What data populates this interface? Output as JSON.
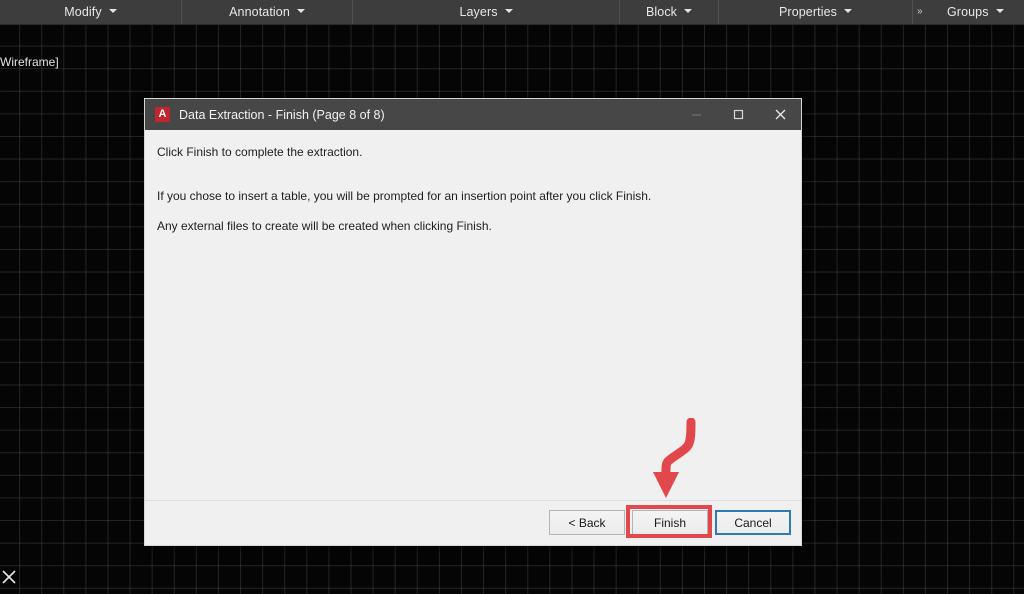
{
  "ribbon": {
    "panels": [
      {
        "label": "Modify",
        "icon": "chevron-down-icon",
        "name": "ribbon-panel-modify"
      },
      {
        "label": "Annotation",
        "icon": "chevron-down-icon",
        "name": "ribbon-panel-annotation"
      },
      {
        "label": "Layers",
        "icon": "chevron-down-icon",
        "name": "ribbon-panel-layers"
      },
      {
        "label": "Block",
        "icon": "chevron-down-icon",
        "name": "ribbon-panel-block"
      },
      {
        "label": "Properties",
        "icon": "chevron-down-icon",
        "name": "ribbon-panel-properties"
      },
      {
        "label": "Groups",
        "icon": "chevron-down-icon",
        "name": "ribbon-panel-groups"
      }
    ],
    "overflow_chevron": "»",
    "background_color": "#3d3d3d"
  },
  "canvas": {
    "viewport_label": "Wireframe]",
    "background_color": "#050505",
    "grid_line_color": "#8c8c8c",
    "crosshair_icon": "x-crosshair-icon"
  },
  "dialog": {
    "title": "Data Extraction - Finish (Page 8 of 8)",
    "logo_letter": "A",
    "logo_color": "#c0272d",
    "titlebar_color": "#474747",
    "window_buttons": {
      "minimize": "minimize-icon",
      "maximize": "maximize-icon",
      "close": "close-icon"
    },
    "body": {
      "line1": "Click Finish to complete the extraction.",
      "line2": "If you chose to insert a table, you will be prompted for an insertion point after you click Finish.",
      "line3": "Any external files to create will be created when clicking Finish."
    },
    "buttons": {
      "back": "< Back",
      "finish": "Finish",
      "cancel": "Cancel"
    },
    "default_button_border_color": "#2d7cb5"
  },
  "annotations": {
    "highlight_color": "#e2484b",
    "highlight_target": "Finish",
    "arrow": "curved-down-arrow"
  }
}
